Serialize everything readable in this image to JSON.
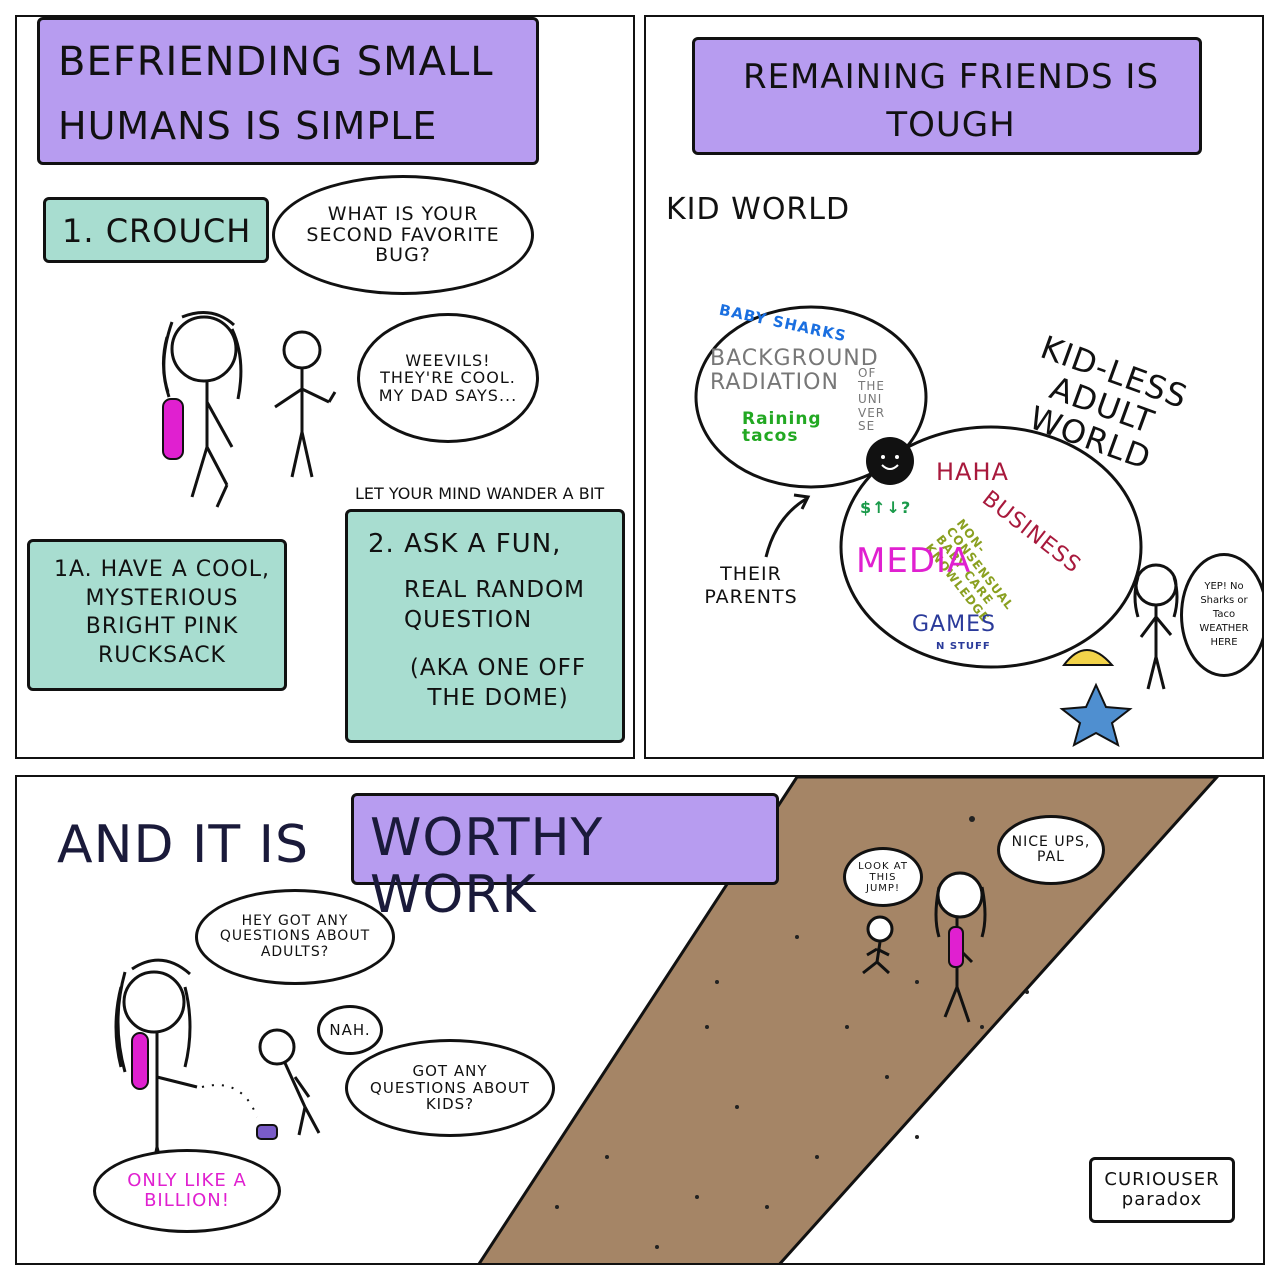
{
  "panel1": {
    "title_line1": "BEFRIENDING SMALL",
    "title_line2": "HUMANS is SIMPLE",
    "step1": "1. CROUCH",
    "bubble_adult": "WHAT IS YOUR SECOND FAVORITE BUG?",
    "bubble_kid": "WEEVILS! THEY'RE COOL. MY DAD SAYS...",
    "step1a": "1a. HAVE A COOL, MYSTERIOUS BRIGHT PINK RUCKSACK",
    "caption": "LET YOUR MIND WANDER A BIT",
    "step2_line1": "2. ASK A FUN,",
    "step2_line2": "REAL RANDOM QUESTION",
    "step2_line3": "(AKA ONE OFF THE DOME)"
  },
  "panel2": {
    "title": "REMAINING FRIENDS IS TOUGH",
    "kid_world": "KID WORLD",
    "adult_world": "KID-LESS ADULT WORLD",
    "kid_circle": {
      "baby_sharks": "BABY SHARKS",
      "background": "BACKGROUND RADIATION",
      "of_the_universe": "OF THE UNIVERSE",
      "raining_tacos": "Raining tacos"
    },
    "adult_circle": {
      "haha": "HAHA",
      "business": "BUSINESS",
      "money": "$↑↓?",
      "non_consensual": "NON-CONSENSUAL BABY CARE KNOWLEDGE",
      "media": "MEDIA",
      "games": "GAMES",
      "n_stuff": "N STUFF"
    },
    "their_parents": "THEIR PARENTS",
    "bubble_yep": "YEP! No Sharks or Taco WEATHER HERE"
  },
  "panel3": {
    "title_plain": "AND IT IS",
    "title_highlight": "WORTHY WORK",
    "bubble_adult": "HEY GOT ANY QUESTIONS ABOUT ADULTS?",
    "bubble_nah": "NAH.",
    "bubble_kid": "GOT ANY QUESTIONS ABOUT KIDS?",
    "bubble_billion": "ONLY LIKE A BILLION!",
    "bubble_jump": "LOOK AT THIS JUMP!",
    "bubble_ups": "NICE UPS, PAL",
    "signature_line1": "CURIOUSER",
    "signature_line2": "paradox"
  },
  "colors": {
    "purple": "#b79cf0",
    "teal": "#a8ddd0",
    "pink": "#e020d0",
    "path": "#a58566"
  }
}
